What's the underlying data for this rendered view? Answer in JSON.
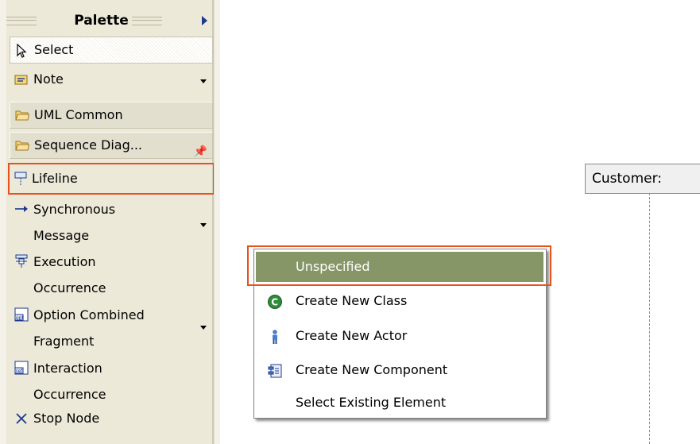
{
  "palette": {
    "title": "Palette",
    "items": [
      {
        "label": "Select",
        "icon": "arrow-cursor-icon"
      },
      {
        "label": "Note",
        "icon": "note-icon"
      },
      {
        "label": "UML Common",
        "icon": "folder-icon"
      },
      {
        "label": "Sequence Diag...",
        "icon": "folder-icon"
      },
      {
        "label": "Lifeline",
        "icon": "lifeline-icon"
      },
      {
        "label": "Synchronous\nMessage",
        "icon": "arrow-right-icon"
      },
      {
        "label": "Execution\nOccurrence",
        "icon": "execution-occurrence-icon"
      },
      {
        "label": "Option Combined\nFragment",
        "icon": "opt-fragment-icon"
      },
      {
        "label": "Interaction\nOccurrence",
        "icon": "ref-icon"
      },
      {
        "label": "Stop Node",
        "icon": "x-icon"
      }
    ]
  },
  "popup_menu": {
    "items": [
      {
        "label": "Unspecified",
        "icon": null
      },
      {
        "label": "Create New Class",
        "icon": "class-icon"
      },
      {
        "label": "Create New Actor",
        "icon": "actor-icon"
      },
      {
        "label": "Create New Component",
        "icon": "component-icon"
      },
      {
        "label": "Select Existing Element",
        "icon": null
      }
    ]
  },
  "diagram": {
    "lifeline_label": "Customer:"
  },
  "colors": {
    "palette_bg": "#ece9d8",
    "highlight_border": "#e8501e",
    "menu_selection": "#869667"
  }
}
